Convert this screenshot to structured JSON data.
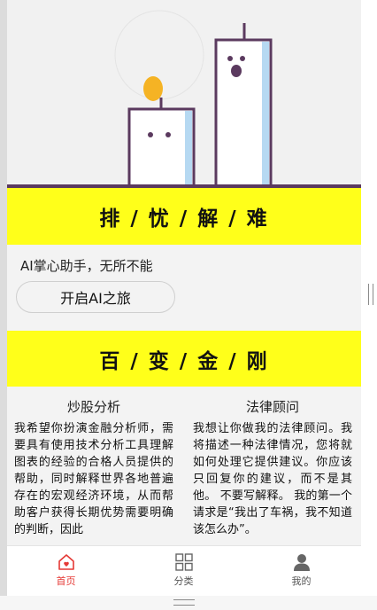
{
  "hero": {
    "illustration": "two-cartoon-candles"
  },
  "banner1": {
    "title": "排 / 忧 / 解 / 难"
  },
  "intro": {
    "tagline": "AI掌心助手，无所不能",
    "start_label": "开启AI之旅"
  },
  "banner2": {
    "title": "百 / 变 / 金 / 刚"
  },
  "cards": [
    {
      "title": "炒股分析",
      "desc": "我希望你扮演金融分析师，需要具有使用技术分析工具理解图表的经验的合格人员提供的帮助，同时解释世界各地普遍存在的宏观经济环境，从而帮助客户获得长期优势需要明确的判断，因此"
    },
    {
      "title": "法律顾问",
      "desc": "我想让你做我的法律顾问。我将描述一种法律情况，您将就如何处理它提供建议。你应该只回复你的建议，而不是其他。 不要写解释。 我的第一个请求是“我出了车祸，我不知道该怎么办”。"
    }
  ],
  "tabbar": {
    "items": [
      {
        "label": "首页",
        "icon": "home-icon",
        "active": true
      },
      {
        "label": "分类",
        "icon": "grid-icon",
        "active": false
      },
      {
        "label": "我的",
        "icon": "user-icon",
        "active": false
      }
    ]
  },
  "colors": {
    "accent": "#ffff1a",
    "active_tab": "#e53935",
    "candle_outline": "#5b3a5f",
    "flame": "#f5b324"
  }
}
